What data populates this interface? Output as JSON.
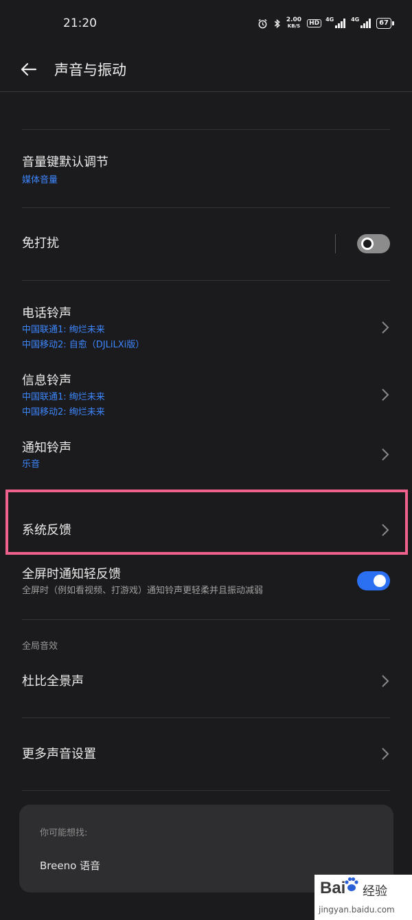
{
  "status_bar": {
    "time": "21:20",
    "speed_value": "2.00",
    "speed_unit": "KB/S",
    "hd": "HD",
    "signal1": "4G",
    "signal2": "4G",
    "battery": "67"
  },
  "header": {
    "title": "声音与振动"
  },
  "settings": {
    "volume_key": {
      "title": "音量键默认调节",
      "value": "媒体音量"
    },
    "dnd": {
      "title": "免打扰",
      "state": "off"
    },
    "phone_ringtone": {
      "title": "电话铃声",
      "line1": "中国联通1: 绚烂未来",
      "line2": "中国移动2: 自愈（DJLiLXi版）"
    },
    "message_ringtone": {
      "title": "信息铃声",
      "line1": "中国联通1: 绚烂未来",
      "line2": "中国移动2: 绚烂未来"
    },
    "notification_ringtone": {
      "title": "通知铃声",
      "value": "乐音"
    },
    "system_feedback": {
      "title": "系统反馈"
    },
    "fullscreen_feedback": {
      "title": "全屏时通知轻反馈",
      "desc": "全屏时（例如看视频、打游戏）通知铃声更轻柔并且振动减弱",
      "state": "on"
    },
    "section_global": "全局音效",
    "dolby": {
      "title": "杜比全景声"
    },
    "more_sound": {
      "title": "更多声音设置"
    }
  },
  "suggestions": {
    "label": "你可能想找:",
    "item": "Breeno 语音"
  },
  "watermark": {
    "logo": "Bai",
    "logo_suffix": "经验",
    "url": "jingyan.baidu.com"
  },
  "colors": {
    "background": "#1b1b1d",
    "accent_blue": "#3d87ff",
    "toggle_on": "#2b6ff2",
    "highlight": "#f0628e",
    "card": "#2e2e30"
  }
}
